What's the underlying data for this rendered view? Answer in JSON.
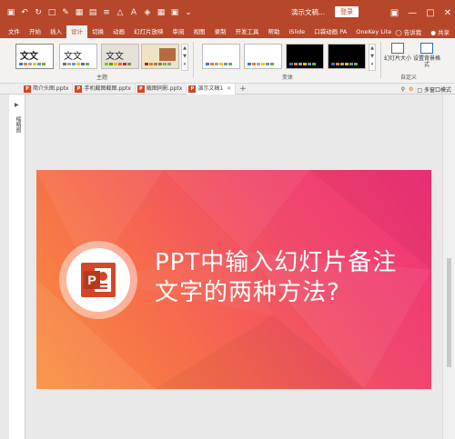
{
  "window": {
    "title": "演示文稿...",
    "login_label": "登录",
    "share_label": "共享",
    "tell_me_label": "告诉我"
  },
  "menu": [
    "文件",
    "开始",
    "插入",
    "设计",
    "切换",
    "动画",
    "幻灯片放映",
    "审阅",
    "视图",
    "录制",
    "开发工具",
    "帮助",
    "iSlide",
    "口袋动画 PA",
    "OneKey Lite"
  ],
  "active_menu": "设计",
  "ribbon": {
    "themes_group_label": "主题",
    "variants_group_label": "变体",
    "customize_group_label": "自定义",
    "theme_labels": [
      "文文",
      "文文",
      "文文",
      ""
    ],
    "slide_size_label": "幻灯片大小",
    "format_bg_label": "设置背景格式"
  },
  "tabs": [
    {
      "label": "简介头图.pptx",
      "active": false
    },
    {
      "label": "手机截图截图.pptx",
      "active": false
    },
    {
      "label": "截图同影.pptx",
      "active": false
    },
    {
      "label": "演示文稿1",
      "active": true
    }
  ],
  "tab_right_label": "多窗口模式",
  "thumb_pane_label": "缩略图",
  "slide": {
    "title_line1": "PPT中输入幻灯片备注",
    "title_line2": "文字的两种方法?",
    "logo_letter": "P"
  },
  "colors": {
    "accent": "#b7472a",
    "slide_start": "#f8903c",
    "slide_end": "#f1307a"
  }
}
